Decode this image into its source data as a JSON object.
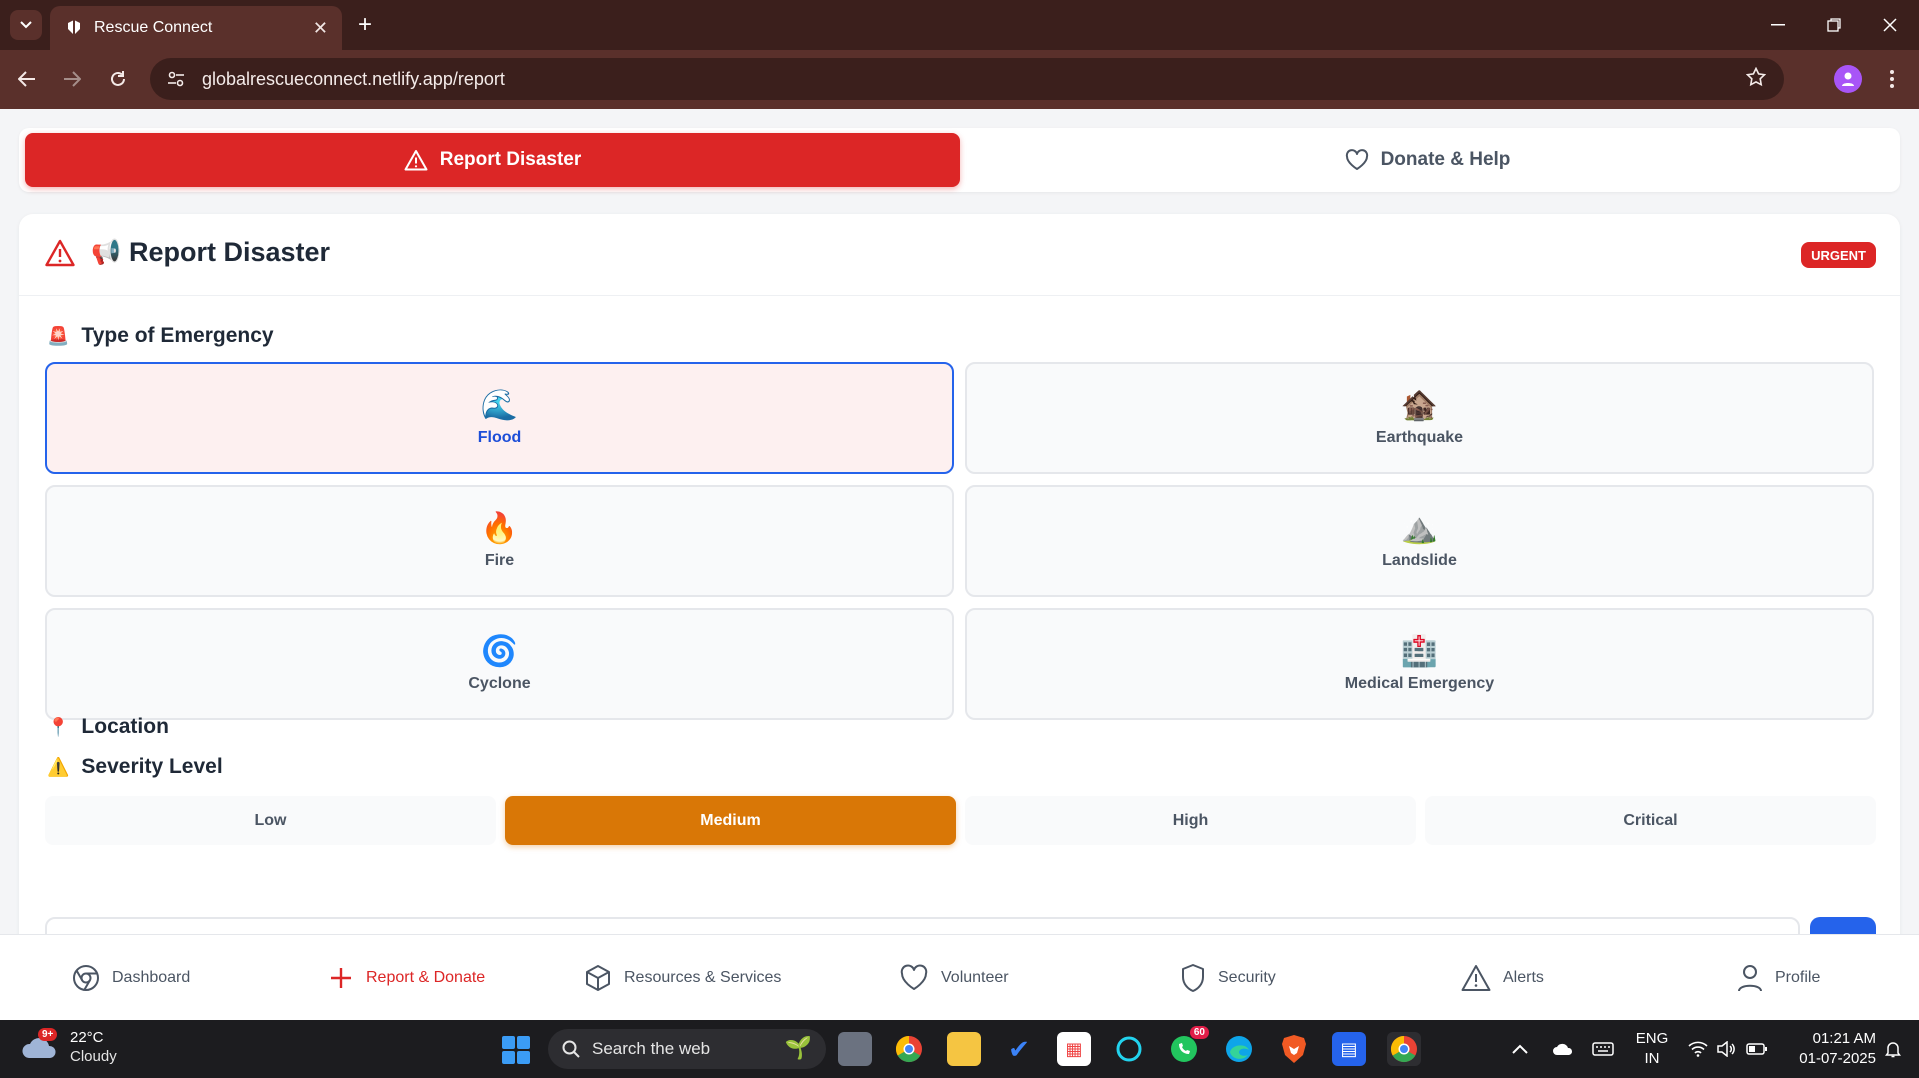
{
  "browser": {
    "tab_title": "Rescue Connect",
    "url": "globalrescueconnect.netlify.app/report"
  },
  "segmented": {
    "report_label": "Report Disaster",
    "donate_label": "Donate & Help"
  },
  "card": {
    "title_emoji": "📢",
    "title": "Report Disaster",
    "badge": "URGENT"
  },
  "emergency": {
    "label_emoji": "🚨",
    "label": "Type of Emergency",
    "types": [
      {
        "icon": "🌊",
        "label": "Flood",
        "selected": true
      },
      {
        "icon": "🏚️",
        "label": "Earthquake",
        "selected": false
      },
      {
        "icon": "🔥",
        "label": "Fire",
        "selected": false
      },
      {
        "icon": "⛰️",
        "label": "Landslide",
        "selected": false
      },
      {
        "icon": "🌀",
        "label": "Cyclone",
        "selected": false
      },
      {
        "icon": "🏥",
        "label": "Medical Emergency",
        "selected": false
      }
    ]
  },
  "severity": {
    "label_emoji": "⚠️",
    "label": "Severity Level",
    "levels": [
      "Low",
      "Medium",
      "High",
      "Critical"
    ],
    "selected": "Medium"
  },
  "location": {
    "label_emoji": "📍",
    "label": "Location"
  },
  "bottom_nav": [
    {
      "label": "Dashboard",
      "icon": "chrome-icon"
    },
    {
      "label": "Report & Donate",
      "icon": "plus-icon",
      "active": true
    },
    {
      "label": "Resources & Services",
      "icon": "box-icon"
    },
    {
      "label": "Volunteer",
      "icon": "heart-icon"
    },
    {
      "label": "Security",
      "icon": "shield-icon"
    },
    {
      "label": "Alerts",
      "icon": "alert-triangle-icon"
    },
    {
      "label": "Profile",
      "icon": "user-icon"
    }
  ],
  "taskbar": {
    "weather_badge": "9+",
    "temperature": "22°C",
    "condition": "Cloudy",
    "search_placeholder": "Search the web",
    "whatsapp_badge": "60",
    "lang_top": "ENG",
    "lang_bottom": "IN",
    "time": "01:21 AM",
    "date": "01-07-2025"
  },
  "colors": {
    "primary_red": "#dc2626",
    "severity_active": "#d97706",
    "selected_border": "#2563eb",
    "browser_frame": "#3b1f1c"
  }
}
